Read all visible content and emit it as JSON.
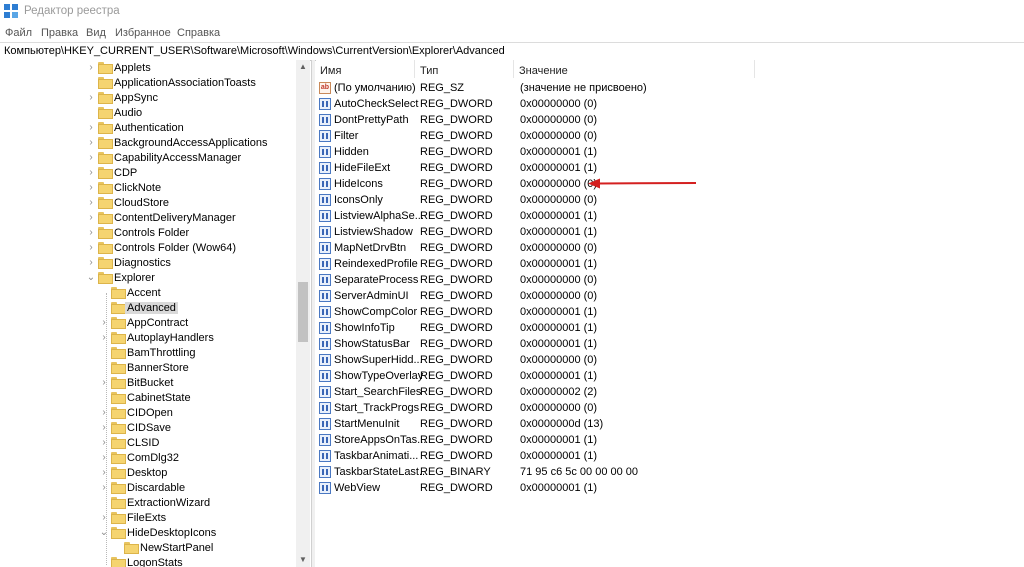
{
  "window": {
    "title": "Редактор реестра"
  },
  "menu": [
    "Файл",
    "Правка",
    "Вид",
    "Избранное",
    "Справка"
  ],
  "address": "Компьютер\\HKEY_CURRENT_USER\\Software\\Microsoft\\Windows\\CurrentVersion\\Explorer\\Advanced",
  "tree": {
    "items": [
      {
        "label": "Applets"
      },
      {
        "label": "ApplicationAssociationToasts"
      },
      {
        "label": "AppSync"
      },
      {
        "label": "Audio"
      },
      {
        "label": "Authentication"
      },
      {
        "label": "BackgroundAccessApplications"
      },
      {
        "label": "CapabilityAccessManager"
      },
      {
        "label": "CDP"
      },
      {
        "label": "ClickNote"
      },
      {
        "label": "CloudStore"
      },
      {
        "label": "ContentDeliveryManager"
      },
      {
        "label": "Controls Folder"
      },
      {
        "label": "Controls Folder (Wow64)"
      },
      {
        "label": "Diagnostics"
      },
      {
        "label": "Explorer"
      },
      {
        "label": "Accent"
      },
      {
        "label": "Advanced"
      },
      {
        "label": "AppContract"
      },
      {
        "label": "AutoplayHandlers"
      },
      {
        "label": "BamThrottling"
      },
      {
        "label": "BannerStore"
      },
      {
        "label": "BitBucket"
      },
      {
        "label": "CabinetState"
      },
      {
        "label": "CIDOpen"
      },
      {
        "label": "CIDSave"
      },
      {
        "label": "CLSID"
      },
      {
        "label": "ComDlg32"
      },
      {
        "label": "Desktop"
      },
      {
        "label": "Discardable"
      },
      {
        "label": "ExtractionWizard"
      },
      {
        "label": "FileExts"
      },
      {
        "label": "HideDesktopIcons"
      },
      {
        "label": "NewStartPanel"
      },
      {
        "label": "LogonStats"
      }
    ]
  },
  "values_table": {
    "columns": [
      "Имя",
      "Тип",
      "Значение"
    ],
    "rows": [
      {
        "name": "(По умолчанию)",
        "type": "REG_SZ",
        "data": "(значение не присвоено)",
        "icon": "string-value-icon"
      },
      {
        "name": "AutoCheckSelect",
        "type": "REG_DWORD",
        "data": "0x00000000 (0)",
        "icon": "binary-value-icon"
      },
      {
        "name": "DontPrettyPath",
        "type": "REG_DWORD",
        "data": "0x00000000 (0)",
        "icon": "binary-value-icon"
      },
      {
        "name": "Filter",
        "type": "REG_DWORD",
        "data": "0x00000000 (0)",
        "icon": "binary-value-icon"
      },
      {
        "name": "Hidden",
        "type": "REG_DWORD",
        "data": "0x00000001 (1)",
        "icon": "binary-value-icon"
      },
      {
        "name": "HideFileExt",
        "type": "REG_DWORD",
        "data": "0x00000001 (1)",
        "icon": "binary-value-icon"
      },
      {
        "name": "HideIcons",
        "type": "REG_DWORD",
        "data": "0x00000000 (0)",
        "icon": "binary-value-icon"
      },
      {
        "name": "IconsOnly",
        "type": "REG_DWORD",
        "data": "0x00000000 (0)",
        "icon": "binary-value-icon"
      },
      {
        "name": "ListviewAlphaSe...",
        "type": "REG_DWORD",
        "data": "0x00000001 (1)",
        "icon": "binary-value-icon"
      },
      {
        "name": "ListviewShadow",
        "type": "REG_DWORD",
        "data": "0x00000001 (1)",
        "icon": "binary-value-icon"
      },
      {
        "name": "MapNetDrvBtn",
        "type": "REG_DWORD",
        "data": "0x00000000 (0)",
        "icon": "binary-value-icon"
      },
      {
        "name": "ReindexedProfile",
        "type": "REG_DWORD",
        "data": "0x00000001 (1)",
        "icon": "binary-value-icon"
      },
      {
        "name": "SeparateProcess",
        "type": "REG_DWORD",
        "data": "0x00000000 (0)",
        "icon": "binary-value-icon"
      },
      {
        "name": "ServerAdminUI",
        "type": "REG_DWORD",
        "data": "0x00000000 (0)",
        "icon": "binary-value-icon"
      },
      {
        "name": "ShowCompColor",
        "type": "REG_DWORD",
        "data": "0x00000001 (1)",
        "icon": "binary-value-icon"
      },
      {
        "name": "ShowInfoTip",
        "type": "REG_DWORD",
        "data": "0x00000001 (1)",
        "icon": "binary-value-icon"
      },
      {
        "name": "ShowStatusBar",
        "type": "REG_DWORD",
        "data": "0x00000001 (1)",
        "icon": "binary-value-icon"
      },
      {
        "name": "ShowSuperHidd...",
        "type": "REG_DWORD",
        "data": "0x00000000 (0)",
        "icon": "binary-value-icon"
      },
      {
        "name": "ShowTypeOverlay",
        "type": "REG_DWORD",
        "data": "0x00000001 (1)",
        "icon": "binary-value-icon"
      },
      {
        "name": "Start_SearchFiles",
        "type": "REG_DWORD",
        "data": "0x00000002 (2)",
        "icon": "binary-value-icon"
      },
      {
        "name": "Start_TrackProgs",
        "type": "REG_DWORD",
        "data": "0x00000000 (0)",
        "icon": "binary-value-icon"
      },
      {
        "name": "StartMenuInit",
        "type": "REG_DWORD",
        "data": "0x0000000d (13)",
        "icon": "binary-value-icon"
      },
      {
        "name": "StoreAppsOnTas...",
        "type": "REG_DWORD",
        "data": "0x00000001 (1)",
        "icon": "binary-value-icon"
      },
      {
        "name": "TaskbarAnimati...",
        "type": "REG_DWORD",
        "data": "0x00000001 (1)",
        "icon": "binary-value-icon"
      },
      {
        "name": "TaskbarStateLast...",
        "type": "REG_BINARY",
        "data": "71 95 c6 5c 00 00 00 00",
        "icon": "binary-value-icon"
      },
      {
        "name": "WebView",
        "type": "REG_DWORD",
        "data": "0x00000001 (1)",
        "icon": "binary-value-icon"
      }
    ]
  },
  "colors": {
    "folder": "#f5d470",
    "selected_bg": "#d9d9d9",
    "annotation_arrow": "#d42020"
  },
  "icons": {
    "app": "regedit-icon",
    "annotation": "red-arrow-icon"
  }
}
